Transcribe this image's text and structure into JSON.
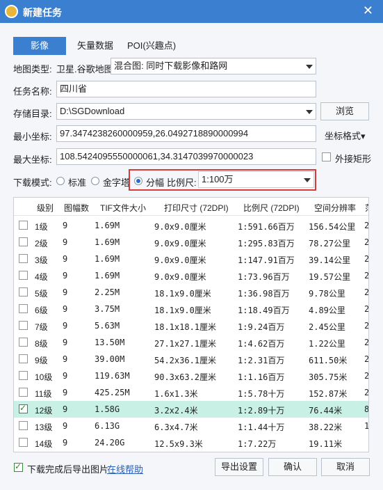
{
  "window": {
    "title": "新建任务",
    "close": "✕"
  },
  "tabs": [
    "影像",
    "矢量数据",
    "POI(兴趣点)"
  ],
  "form": {
    "map_type_label": "地图类型:",
    "map_type_value": "卫星.谷歌地图",
    "map_mode_value": "混合图: 同时下载影像和路网",
    "task_name_label": "任务名称:",
    "task_name_value": "四川省",
    "save_dir_label": "存储目录:",
    "save_dir_value": "D:\\SGDownload",
    "browse_button": "浏览",
    "min_coord_label": "最小坐标:",
    "min_coord_value": "97.3474238260000959,26.0492718890000994",
    "coord_format_button": "坐标格式▾",
    "max_coord_label": "最大坐标:",
    "max_coord_value": "108.5424095550000061,34.3147039970000023",
    "bounding_rect_label": "外接矩形",
    "download_mode_label": "下载模式:",
    "mode_standard": "标准",
    "mode_pyramid": "金字塔",
    "mode_tiled": "分幅",
    "scale_label": "比例尺:",
    "scale_value": "1:100万"
  },
  "table": {
    "headers": [
      "级别",
      "图幅数",
      "TIF文件大小",
      "打印尺寸 (72DPI)",
      "比例尺 (72DPI)",
      "空间分辨率",
      "范"
    ],
    "rows": [
      {
        "level": "1级",
        "count": "9",
        "size": "1.69M",
        "print": "9.0x9.0厘米",
        "scale": "1:591.66百万",
        "res": "156.54公里",
        "extra": "2",
        "checked": false
      },
      {
        "level": "2级",
        "count": "9",
        "size": "1.69M",
        "print": "9.0x9.0厘米",
        "scale": "1:295.83百万",
        "res": "78.27公里",
        "extra": "2",
        "checked": false
      },
      {
        "level": "3级",
        "count": "9",
        "size": "1.69M",
        "print": "9.0x9.0厘米",
        "scale": "1:147.91百万",
        "res": "39.14公里",
        "extra": "2",
        "checked": false
      },
      {
        "level": "4级",
        "count": "9",
        "size": "1.69M",
        "print": "9.0x9.0厘米",
        "scale": "1:73.96百万",
        "res": "19.57公里",
        "extra": "2",
        "checked": false
      },
      {
        "level": "5级",
        "count": "9",
        "size": "2.25M",
        "print": "18.1x9.0厘米",
        "scale": "1:36.98百万",
        "res": "9.78公里",
        "extra": "2",
        "checked": false
      },
      {
        "level": "6级",
        "count": "9",
        "size": "3.75M",
        "print": "18.1x9.0厘米",
        "scale": "1:18.49百万",
        "res": "4.89公里",
        "extra": "2",
        "checked": false
      },
      {
        "level": "7级",
        "count": "9",
        "size": "5.63M",
        "print": "18.1x18.1厘米",
        "scale": "1:9.24百万",
        "res": "2.45公里",
        "extra": "2",
        "checked": false
      },
      {
        "level": "8级",
        "count": "9",
        "size": "13.50M",
        "print": "27.1x27.1厘米",
        "scale": "1:4.62百万",
        "res": "1.22公里",
        "extra": "2",
        "checked": false
      },
      {
        "level": "9级",
        "count": "9",
        "size": "39.00M",
        "print": "54.2x36.1厘米",
        "scale": "1:2.31百万",
        "res": "611.50米",
        "extra": "2",
        "checked": false
      },
      {
        "level": "10级",
        "count": "9",
        "size": "119.63M",
        "print": "90.3x63.2厘米",
        "scale": "1:1.16百万",
        "res": "305.75米",
        "extra": "2",
        "checked": false
      },
      {
        "level": "11级",
        "count": "9",
        "size": "425.25M",
        "print": "1.6x1.3米",
        "scale": "1:5.78十万",
        "res": "152.87米",
        "extra": "2",
        "checked": false
      },
      {
        "level": "12级",
        "count": "9",
        "size": "1.58G",
        "print": "3.2x2.4米",
        "scale": "1:2.89十万",
        "res": "76.44米",
        "extra": "8",
        "checked": true
      },
      {
        "level": "13级",
        "count": "9",
        "size": "6.13G",
        "print": "6.3x4.7米",
        "scale": "1:1.44十万",
        "res": "38.22米",
        "extra": "1",
        "checked": false
      },
      {
        "level": "14级",
        "count": "9",
        "size": "24.20G",
        "print": "12.5x9.3米",
        "scale": "1:7.22万",
        "res": "19.11米",
        "extra": "",
        "checked": false
      }
    ]
  },
  "footer": {
    "export_checkbox_label": "下载完成后导出图片",
    "online_help": "在线帮助",
    "export_settings": "导出设置",
    "ok": "确认",
    "cancel": "取消"
  }
}
